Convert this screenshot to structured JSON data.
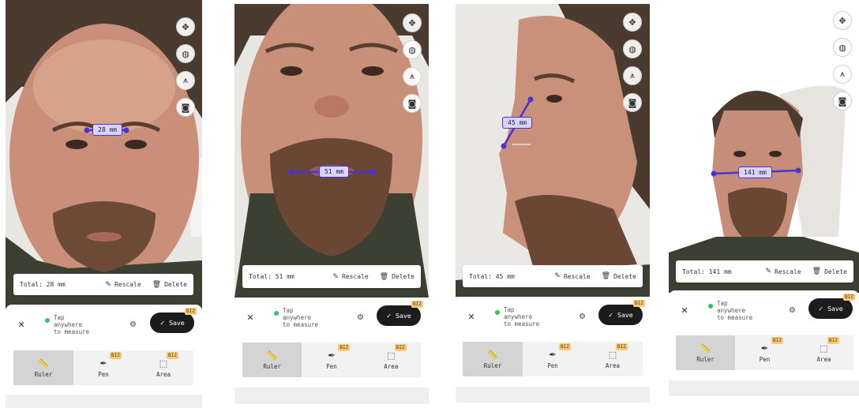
{
  "screens": [
    {
      "measurement": {
        "label": "28 mm",
        "orientation": "horizontal"
      },
      "total_text": "Total: 28 mm",
      "rescale_label": "Rescale",
      "delete_label": "Delete",
      "hint_lines": [
        "Tap",
        "anywhere",
        "to measure"
      ],
      "save_label": "Save",
      "biz_badge": "BIZ",
      "tabs": [
        {
          "label": "Ruler",
          "biz": ""
        },
        {
          "label": "Pen",
          "biz": "BIZ"
        },
        {
          "label": "Area",
          "biz": "BIZ"
        }
      ]
    },
    {
      "measurement": {
        "label": "51 mm",
        "orientation": "horizontal"
      },
      "total_text": "Total: 51 mm",
      "rescale_label": "Rescale",
      "delete_label": "Delete",
      "hint_lines": [
        "Tap",
        "anywhere",
        "to measure"
      ],
      "save_label": "Save",
      "biz_badge": "BIZ",
      "tabs": [
        {
          "label": "Ruler",
          "biz": ""
        },
        {
          "label": "Pen",
          "biz": "BIZ"
        },
        {
          "label": "Area",
          "biz": "BIZ"
        }
      ]
    },
    {
      "measurement": {
        "label": "45 mm",
        "orientation": "diagonal"
      },
      "total_text": "Total: 45 mm",
      "rescale_label": "Rescale",
      "delete_label": "Delete",
      "hint_lines": [
        "Tap",
        "anywhere",
        "to measure"
      ],
      "save_label": "Save",
      "biz_badge": "BIZ",
      "tabs": [
        {
          "label": "Ruler",
          "biz": ""
        },
        {
          "label": "Pen",
          "biz": "BIZ"
        },
        {
          "label": "Area",
          "biz": "BIZ"
        }
      ]
    },
    {
      "measurement": {
        "label": "141 mm",
        "orientation": "horizontal"
      },
      "total_text": "Total: 141 mm",
      "rescale_label": "Rescale",
      "delete_label": "Delete",
      "hint_lines": [
        "Tap",
        "anywhere",
        "to measure"
      ],
      "save_label": "Save",
      "biz_badge": "BIZ",
      "tabs": [
        {
          "label": "Ruler",
          "biz": ""
        },
        {
          "label": "Pen",
          "biz": "BIZ"
        },
        {
          "label": "Area",
          "biz": "BIZ"
        }
      ]
    }
  ],
  "toolbar_icons": [
    "rotate-icon",
    "texture-icon",
    "tripod-icon",
    "camera-icon"
  ],
  "colors": {
    "accent": "#4a32d8",
    "label_bg": "#d9d4ff",
    "status_dot": "#35c463",
    "biz_badge": "#f7c97a",
    "save_bg": "#1c1c1c"
  }
}
